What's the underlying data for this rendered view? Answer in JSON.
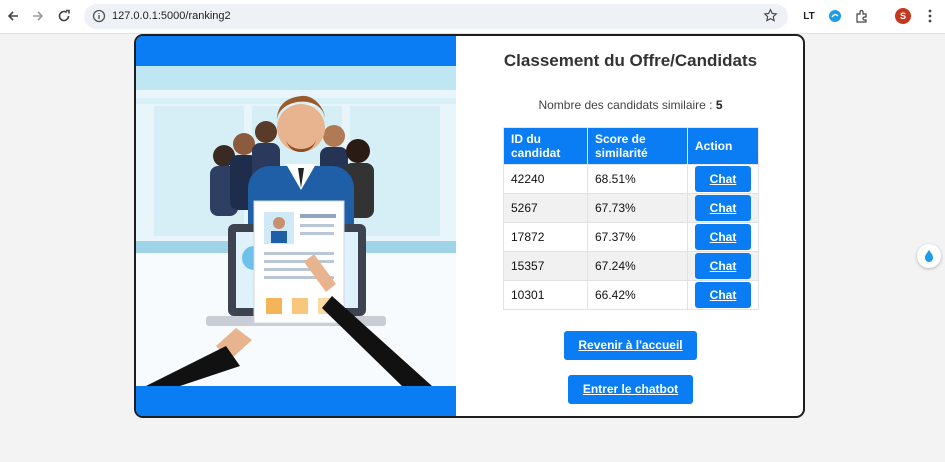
{
  "browser": {
    "url": "127.0.0.1:5000/ranking2",
    "profile_initial": "S",
    "ext_lt": "LT"
  },
  "page": {
    "title": "Classement du Offre/Candidats",
    "count_label": "Nombre des candidats similaire :",
    "count_value": "5",
    "table": {
      "headers": [
        "ID du candidat",
        "Score de similarité",
        "Action"
      ],
      "rows": [
        {
          "id": "42240",
          "score": "68.51%",
          "action": "Chat"
        },
        {
          "id": "5267",
          "score": "67.73%",
          "action": "Chat"
        },
        {
          "id": "17872",
          "score": "67.37%",
          "action": "Chat"
        },
        {
          "id": "15357",
          "score": "67.24%",
          "action": "Chat"
        },
        {
          "id": "10301",
          "score": "66.42%",
          "action": "Chat"
        }
      ]
    },
    "back_button": "Revenir à l'accueil",
    "chatbot_button": "Entrer le chatbot"
  },
  "colors": {
    "primary": "#0a7df5",
    "card_border": "#1f1f1f"
  }
}
